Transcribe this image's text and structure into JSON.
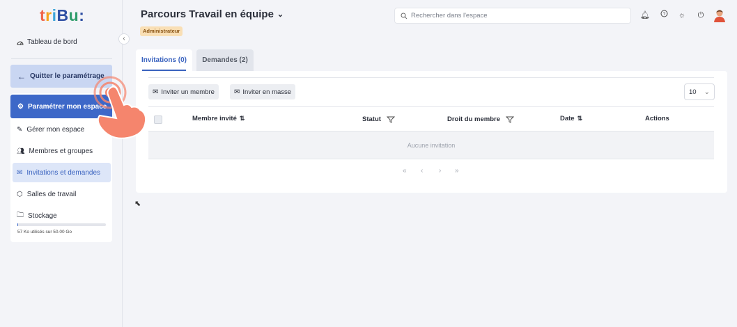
{
  "app": {
    "logo_text": "tribu:",
    "colors": {
      "accent": "#3d68c8",
      "active_bg": "#dde6f8",
      "badge_bg": "#f9dfb5",
      "hand": "#f5856d"
    }
  },
  "sidebar": {
    "dashboard_label": "Tableau de bord",
    "quit_label": "Quitter le paramétrage",
    "settings_label": "Paramétrer mon espace",
    "items": [
      {
        "label": "Gérer mon espace",
        "icon": "wrench-icon"
      },
      {
        "label": "Membres et groupes",
        "icon": "users-icon"
      },
      {
        "label": "Invitations et demandes",
        "icon": "mail-icon",
        "active": true
      },
      {
        "label": "Salles de travail",
        "icon": "box-icon"
      },
      {
        "label": "Stockage",
        "icon": "folder-icon"
      }
    ],
    "storage_text": "57 Ko utilisés sur 50.00 Go",
    "storage_used_fraction": 0.001
  },
  "header": {
    "title": "Parcours Travail en équipe",
    "role_badge": "Administrateur",
    "search_placeholder": "Rechercher dans l'espace"
  },
  "tabs": [
    {
      "label": "Invitations (0)",
      "active": true
    },
    {
      "label": "Demandes (2)",
      "active": false
    }
  ],
  "toolbar": {
    "invite_member": "Inviter un membre",
    "invite_bulk": "Inviter en masse",
    "page_size": "10"
  },
  "table": {
    "columns": {
      "member": "Membre invité",
      "status": "Statut",
      "right": "Droit du membre",
      "date": "Date",
      "actions": "Actions"
    },
    "empty_text": "Aucune invitation"
  },
  "pager": {
    "first": "«",
    "prev": "‹",
    "next": "›",
    "last": "»"
  }
}
